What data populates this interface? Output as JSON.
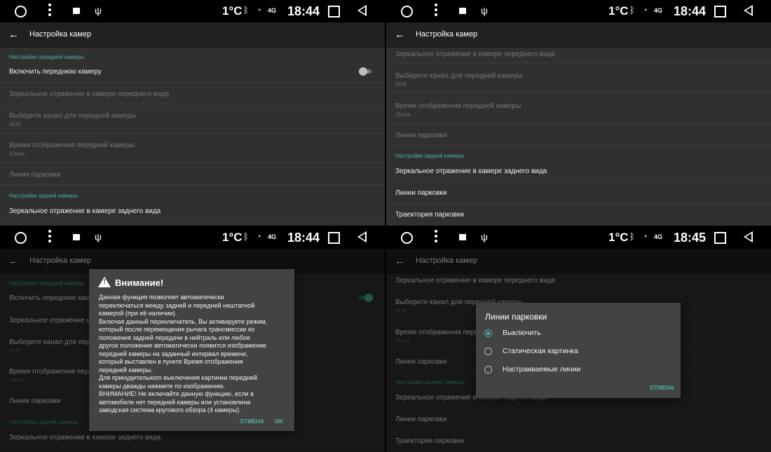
{
  "appbar_title": "Настройка камер",
  "status": {
    "temp": "1°C",
    "net": "4G",
    "time1": "18:44",
    "time2": "18:44",
    "time3": "18:44",
    "time4": "18:45"
  },
  "headers": {
    "front": "Настройки передней камеры",
    "rear": "Настройки задней камеры"
  },
  "items": {
    "enable_front": "Включить переднюю камеру",
    "mirror_front": "Зеркальное отражение в камере переднего вида",
    "channel_front": "Выберите канал для передней камеры",
    "channel_front_value": "AUX",
    "time_front": "Время отображения передней камеры",
    "time_front_value": "10сек.",
    "parking_lines": "Линии парковки",
    "mirror_rear": "Зеркальное отражение в камере заднего вида",
    "trajectory": "Траектория парковки"
  },
  "warning_dialog": {
    "title": "Внимание!",
    "body": "Данная функция позволяет автоматически\nпереключаться между задней и передней нештатной\nкамерой (при её наличии).\nВключая данный переключатель, Вы активируете режим,\nкоторый после перемещения рычага трансмиссии из\nположения задней передачи в нейтраль или любое\nдругое положение автоматически появится изображение\nпередней камеры на заданный интервал времени,\nкоторый выставлен в пункте Время отображения\nпередней камеры.\nДля принудительного выключения картинки передней\nкамеры дважды нажмите по изображению.\nВНИМАНИЕ! Не включайте данную функцию, если в\nавтомобиле нет передней камеры или установлена\nзаводская система кругового обзора (4 камеры).",
    "cancel": "ОТМЕНА",
    "ok": "OK"
  },
  "parking_dialog": {
    "title": "Линии парковки",
    "options": [
      "Выключить",
      "Статическая картинка",
      "Настраиваемые линии"
    ],
    "selected": "Выключить",
    "cancel": "ОТМЕНА"
  },
  "colors": {
    "accent": "#4fb0a3",
    "background": "#303030",
    "appbar": "#212121",
    "statusbar": "#000000"
  },
  "icons": [
    "home-circle-icon",
    "overflow-menu-icon",
    "image-icon",
    "usb-icon",
    "bluetooth-icon",
    "wifi-icon",
    "signal-icon",
    "recents-square-icon",
    "back-triangle-icon",
    "arrow-back-icon",
    "warning-icon"
  ]
}
